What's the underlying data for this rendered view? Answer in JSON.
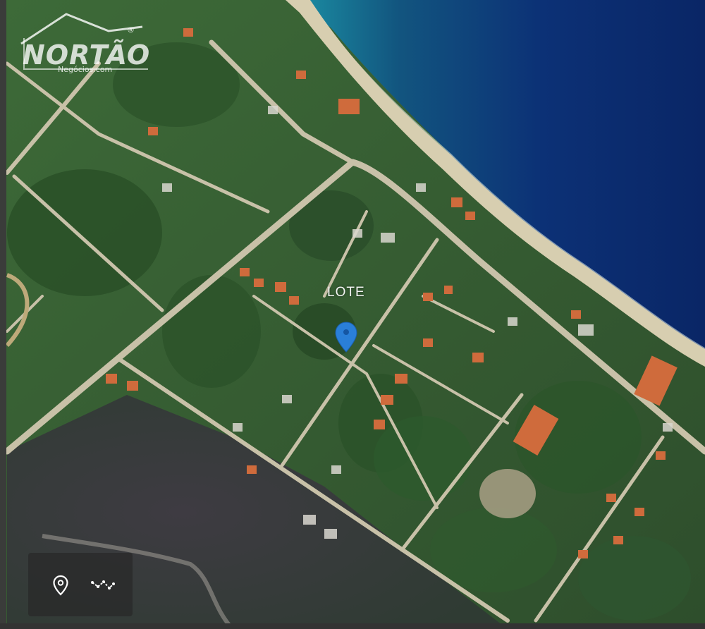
{
  "watermark": {
    "brand": "NORTÃO",
    "subtitle": "Negócios.com",
    "registered_mark": "®"
  },
  "map": {
    "label": "LOTE",
    "pin_color": "#2a7fd8",
    "colors": {
      "ocean_deep": "#0b2a6e",
      "ocean_shallow": "#1c8aa0",
      "beach": "#d9cfb4",
      "vegetation": "#2f5a2c",
      "wetland": "#3a3a3e",
      "road": "#c9c2aa",
      "roof": "#d06a3a"
    }
  },
  "controls": {
    "location_icon": "map-pin-outline-icon",
    "route_icon": "route-polyline-icon"
  }
}
